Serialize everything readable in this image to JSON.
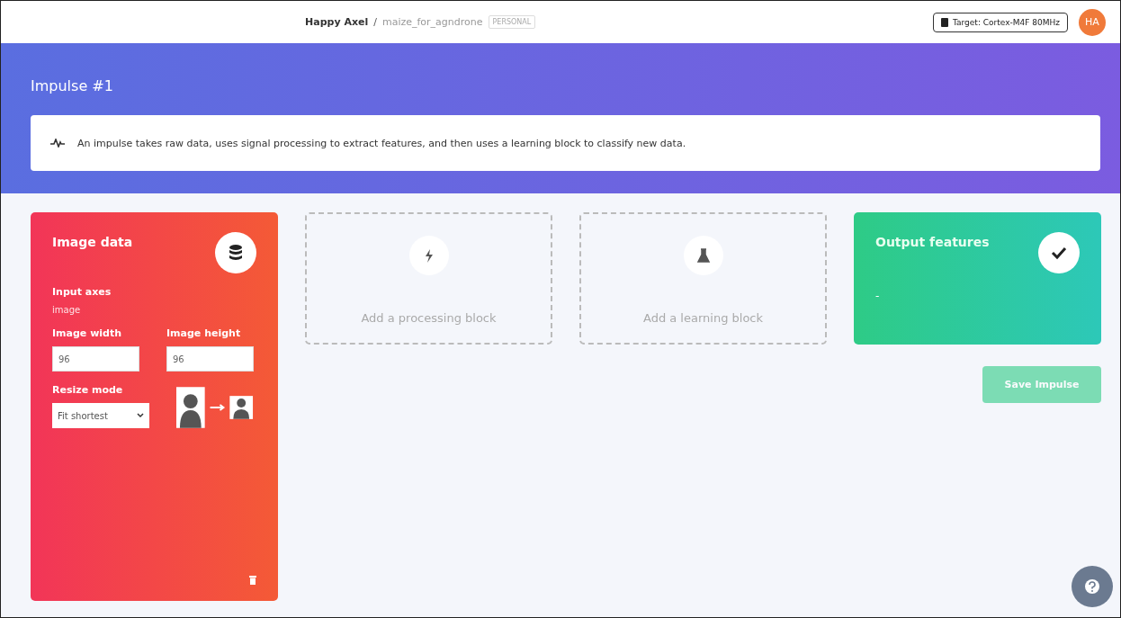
{
  "topbar": {
    "user": "Happy Axel",
    "separator": "/",
    "project": "maize_for_agndrone",
    "badge": "PERSONAL",
    "target": "Target: Cortex-M4F 80MHz",
    "avatar": "HA"
  },
  "header": {
    "title": "Impulse #1",
    "info": "An impulse takes raw data, uses signal processing to extract features, and then uses a learning block to classify new data."
  },
  "input_block": {
    "title": "Image data",
    "axes_label": "Input axes",
    "axes_value": "image",
    "width_label": "Image width",
    "width_value": "96",
    "height_label": "Image height",
    "height_value": "96",
    "resize_label": "Resize mode",
    "resize_value": "Fit shortest"
  },
  "add_blocks": [
    {
      "kind": "processing",
      "label": "Add a processing block"
    },
    {
      "kind": "learning",
      "label": "Add a learning block"
    }
  ],
  "output_block": {
    "title": "Output features",
    "value": "-"
  },
  "save_button": {
    "label": "Save Impulse",
    "disabled": true
  }
}
